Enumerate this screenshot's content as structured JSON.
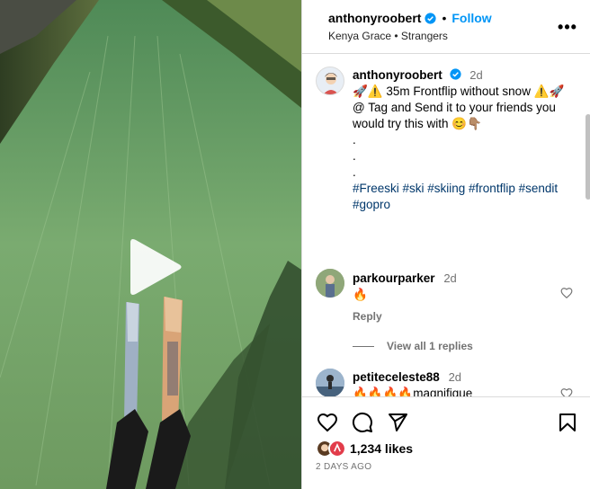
{
  "post": {
    "username": "anthonyroobert",
    "follow_label": "Follow",
    "subtitle": "Kenya Grace • Strangers",
    "more_label": "•••"
  },
  "caption": {
    "username": "anthonyroobert",
    "time": "2d",
    "line1": "🚀⚠️ 35m Frontflip without snow ⚠️🚀",
    "line2": "@ Tag and Send it to your friends you would try this with 😊👇🏽",
    "dot1": ".",
    "dot2": ".",
    "dot3": ".",
    "hashtags": "#Freeski #ski #skiing #frontflip #sendit #gopro"
  },
  "comments": [
    {
      "username": "parkourparker",
      "time": "2d",
      "text": "🔥",
      "reply_label": "Reply",
      "view_replies": "View all 1 replies"
    },
    {
      "username": "petiteceleste88",
      "time": "2d",
      "text": "🔥🔥🔥🔥magnifique"
    }
  ],
  "footer": {
    "likes": "1,234 likes",
    "date": "2 DAYS AGO"
  },
  "icons": {
    "verified": "verified-badge-icon",
    "play": "play-icon",
    "heart": "heart-icon",
    "comment": "comment-icon",
    "share": "share-icon",
    "save": "bookmark-icon"
  },
  "colors": {
    "accent": "#0095f6",
    "hashtag": "#00376b",
    "muted": "#737373"
  }
}
